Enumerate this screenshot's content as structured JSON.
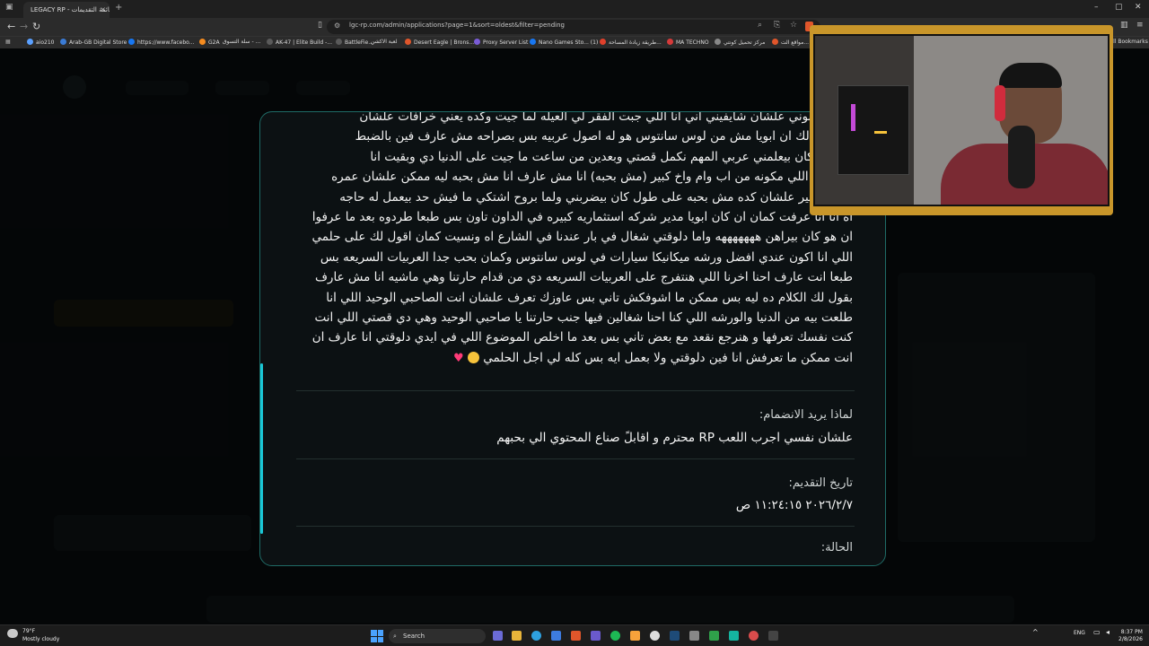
{
  "browser": {
    "tab_title": "LEGACY RP - قائمة التقديمات",
    "tab_close": "×",
    "new_tab": "+",
    "url": "lgc-rp.com/admin/applications?page=1&sort=oldest&filter=pending",
    "bookmarks": [
      {
        "label": "aio210",
        "color": "#5aa0ff"
      },
      {
        "label": "Arab-GB Digital Store",
        "color": "#3a7bd5"
      },
      {
        "label": "https://www.facebo...",
        "color": "#1877f2"
      },
      {
        "label": "G2A",
        "color": "#f58b1f"
      },
      {
        "label": "سلة التسوق - ...",
        "color": "#888888"
      },
      {
        "label": "AK-47 | Elite Build -...",
        "color": "#5a5a5a"
      },
      {
        "label": "BattleFie...",
        "color": "#5a5a5a"
      },
      {
        "label": "لعبة الاكشن",
        "color": "#5a5a5a"
      },
      {
        "label": "Desert Eagle | Brons...",
        "color": "#e0562b"
      },
      {
        "label": "Proxy Server List",
        "color": "#7a5cd6"
      },
      {
        "label": "Nano Games Sto... (1)",
        "color": "#1877f2"
      },
      {
        "label": "طريقة زيادة المساحة...",
        "color": "#e0402b"
      },
      {
        "label": "MA TECHNO",
        "color": "#d63a3a"
      },
      {
        "label": "مركز تحميل كونتي",
        "color": "#888888"
      },
      {
        "label": "مواقع الت...",
        "color": "#e0562b"
      },
      {
        "label": "All Bookmarks",
        "color": "#888888"
      }
    ]
  },
  "application": {
    "story_lines": [
      "مش بيحبوني علشان شايفيني اني انا اللي جبت الفقر لي العيله لما جيت وكده يعني خرافات علشان",
      "ت اقول لك ان ابويا مش من لوس سانتوس هو له اصول عربيه بس بصراحه مش عارف فين بالضبط",
      "فت لما كان بيعلمني عربي المهم نكمل قصتي وبعدين من ساعت ما جيت على الدنيا دي وبقيت انا",
      "ي العيله اللي مكونه من اب وام واخ كبير (مش بحبه) انا مش عارف انا مش بحبه ليه ممكن علشان عمره",
      "ي كاخ كبير علشان كده مش بحبه على طول كان بيضربني ولما بروح اشتكي ما فيش حد بيعمل له حاجه",
      "اه انا انا عرفت كمان ان كان ابويا مدير شركه استثماريه كبيره في الداون تاون بس طبعا طردوه بعد ما عرفوا",
      "ان هو كان بيراهن هههههههه واما دلوقتي شغال في بار عندنا في الشارع اه ونسيت كمان اقول لك على حلمي",
      "اللي انا اكون عندي افضل ورشه ميكانيكا سيارات في لوس سانتوس وكمان بحب جدا العربيات السريعه بس",
      "طبعا انت عارف احنا اخرنا اللي هنتفرج على العربيات السريعه دي من قدام حارتنا وهي ماشيه انا مش عارف",
      "بقول لك الكلام ده ليه بس ممكن ما اشوفكش تاني بس عاوزك تعرف علشان انت الصاحبي الوحيد اللي انا",
      "طلعت بيه من الدنيا والورشه اللي كنا احنا شغالين فيها جنب حارتنا يا صاحبي الوحيد وهي دي قصتي اللي انت",
      "كنت نفسك تعرفها و هنرجع نقعد مع بعض تاني بس بعد ما اخلص الموضوع اللي في ايدي دلوقتي انا عارف ان",
      "انت ممكن ما تعرفش انا فين دلوقتي ولا بعمل ايه بس كله لي اجل الحلمي"
    ],
    "why_join_label": "لماذا يريد الانضمام:",
    "why_join_value": "علشان نفسي اجرب اللعب RP محترم و اقابلً صناع المحتوي الي بحبهم",
    "date_label": "تاريخ التقديم:",
    "date_value": "٢٠٢٦/٢/٧ ١١:٢٤:١٥ ص",
    "status_label": "الحالة:"
  },
  "taskbar": {
    "weather_temp": "79°F",
    "weather_desc": "Mostly cloudy",
    "search_placeholder": "Search",
    "lang": "ENG",
    "time": "8:37 PM",
    "date": "2/8/2026"
  },
  "colors": {
    "modal_border": "#1f6b66",
    "scroll_accent": "#1ac7d6",
    "cam_frame": "#c9962a"
  }
}
